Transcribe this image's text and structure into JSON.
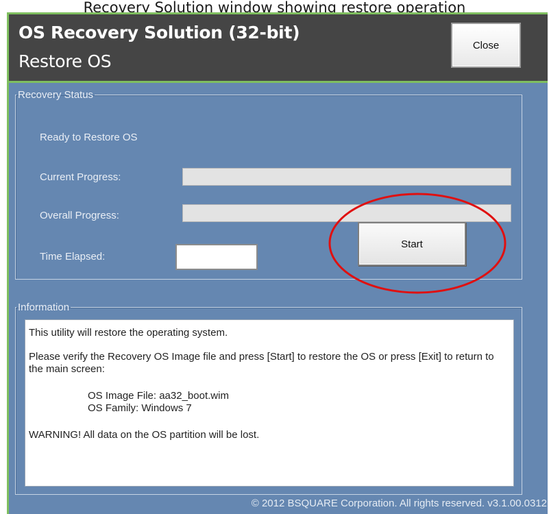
{
  "caption": "Recovery Solution window showing restore operation",
  "header": {
    "title": "OS Recovery Solution (32-bit)",
    "subtitle": "Restore OS",
    "close_label": "Close"
  },
  "recovery_status": {
    "legend": "Recovery Status",
    "status_text": "Ready to Restore OS",
    "current_progress_label": "Current Progress:",
    "current_progress": 0,
    "overall_progress_label": "Overall Progress:",
    "overall_progress": 0,
    "time_elapsed_label": "Time Elapsed:",
    "time_elapsed_value": "",
    "start_label": "Start"
  },
  "information": {
    "legend": "Information",
    "intro": "This utility will restore the operating system.",
    "verify": "Please verify the Recovery OS Image file and press [Start] to restore the OS or press [Exit] to return to the main screen:",
    "image_file": "OS Image File: aa32_boot.wim",
    "os_family": "OS Family: Windows 7",
    "warning": "WARNING! All data on the OS partition will be lost."
  },
  "footer": "© 2012 BSQUARE Corporation. All rights reserved. v3.1.00.0312",
  "colors": {
    "window_bg": "#6587b1",
    "header_bg": "#454545",
    "accent_border": "#7fbf5f",
    "highlight_circle": "#e01010"
  }
}
